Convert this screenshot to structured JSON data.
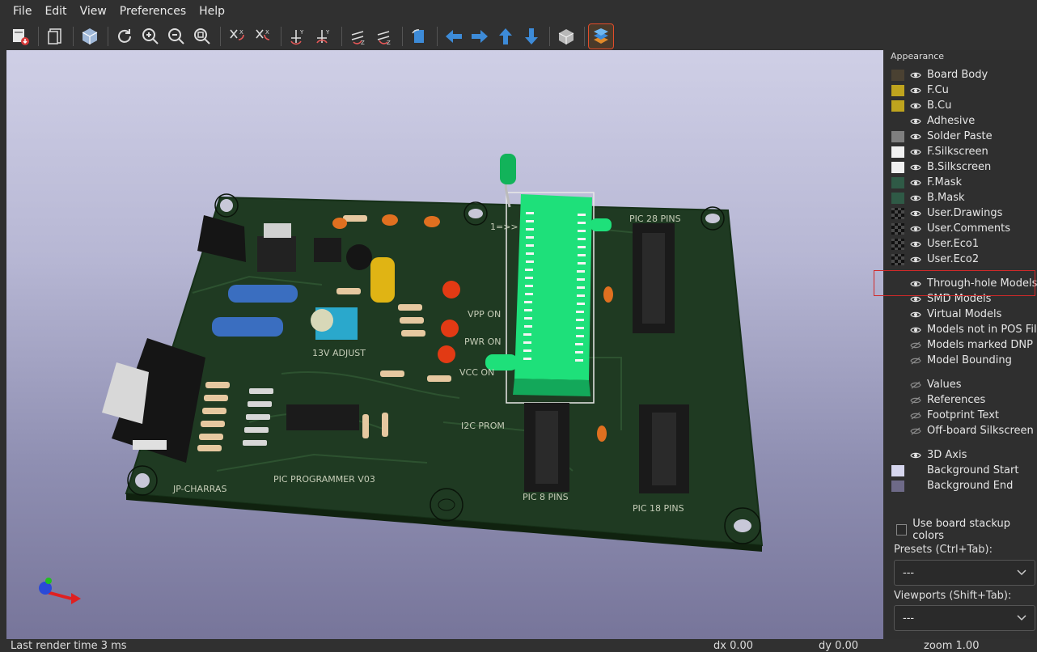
{
  "menu": [
    "File",
    "Edit",
    "View",
    "Preferences",
    "Help"
  ],
  "toolbar_icons": [
    "export-icon",
    "copy-icon",
    "3d-cube-icon",
    "reload-icon",
    "zoom-in-icon",
    "zoom-out-icon",
    "zoom-fit-icon",
    "rotate-x-cw-icon",
    "rotate-x-ccw-icon",
    "rotate-y-cw-icon",
    "rotate-y-ccw-icon",
    "rotate-z-cw-icon",
    "rotate-z-ccw-icon",
    "flip-board-icon",
    "move-left-icon",
    "move-right-icon",
    "move-up-icon",
    "move-down-icon",
    "orthographic-icon",
    "appearance-manager-icon"
  ],
  "sidebar": {
    "title": "Appearance",
    "layers": [
      {
        "label": "Board Body",
        "color": "#4a4132",
        "eye": true
      },
      {
        "label": "F.Cu",
        "color": "#bfa41e",
        "eye": true
      },
      {
        "label": "B.Cu",
        "color": "#bfa41e",
        "eye": true
      },
      {
        "label": "Adhesive",
        "color": "",
        "eye": true
      },
      {
        "label": "Solder Paste",
        "color": "#7f7f7f",
        "eye": true
      },
      {
        "label": "F.Silkscreen",
        "color": "#f0f0f0",
        "eye": true
      },
      {
        "label": "B.Silkscreen",
        "color": "#f0f0f0",
        "eye": true
      },
      {
        "label": "F.Mask",
        "color": "#2f5a46",
        "eye": true
      },
      {
        "label": "B.Mask",
        "color": "#2f5a46",
        "eye": true
      },
      {
        "label": "User.Drawings",
        "color": "checker",
        "eye": true
      },
      {
        "label": "User.Comments",
        "color": "checker",
        "eye": true
      },
      {
        "label": "User.Eco1",
        "color": "checker",
        "eye": true
      },
      {
        "label": "User.Eco2",
        "color": "checker",
        "eye": true
      }
    ],
    "models": [
      {
        "label": "Through-hole Models",
        "eye": true
      },
      {
        "label": "SMD Models",
        "eye": true
      },
      {
        "label": "Virtual Models",
        "eye": true
      },
      {
        "label": "Models not in POS File",
        "eye": true
      },
      {
        "label": "Models marked DNP",
        "eye": false
      },
      {
        "label": "Model Bounding",
        "eye": false
      }
    ],
    "text_layers": [
      {
        "label": "Values",
        "eye": false
      },
      {
        "label": "References",
        "eye": false
      },
      {
        "label": "Footprint Text",
        "eye": false
      },
      {
        "label": "Off-board Silkscreen",
        "eye": false
      }
    ],
    "extras": [
      {
        "label": "3D Axis",
        "color": "",
        "eye": true
      },
      {
        "label": "Background Start",
        "color": "#d6d6ee",
        "eye": null
      },
      {
        "label": "Background End",
        "color": "#6e6a88",
        "eye": null
      }
    ],
    "use_stackup_colors": "Use board stackup colors",
    "presets_label": "Presets (Ctrl+Tab):",
    "presets_value": "---",
    "viewports_label": "Viewports (Shift+Tab):",
    "viewports_value": "---"
  },
  "board": {
    "silk_texts": [
      "VPP ON",
      "PWR ON",
      "VCC ON",
      "13V ADJUST",
      "I2C PROM",
      "PIC PROGRAMMER V03",
      "JP-CHARRAS",
      "PIC 8 PINS",
      "PIC 18 PINS",
      "PIC 28 PINS",
      "1=>>"
    ]
  },
  "status": {
    "render_time": "Last render time 3 ms",
    "dx": "dx 0.00",
    "dy": "dy 0.00",
    "zoom": "zoom 1.00"
  }
}
